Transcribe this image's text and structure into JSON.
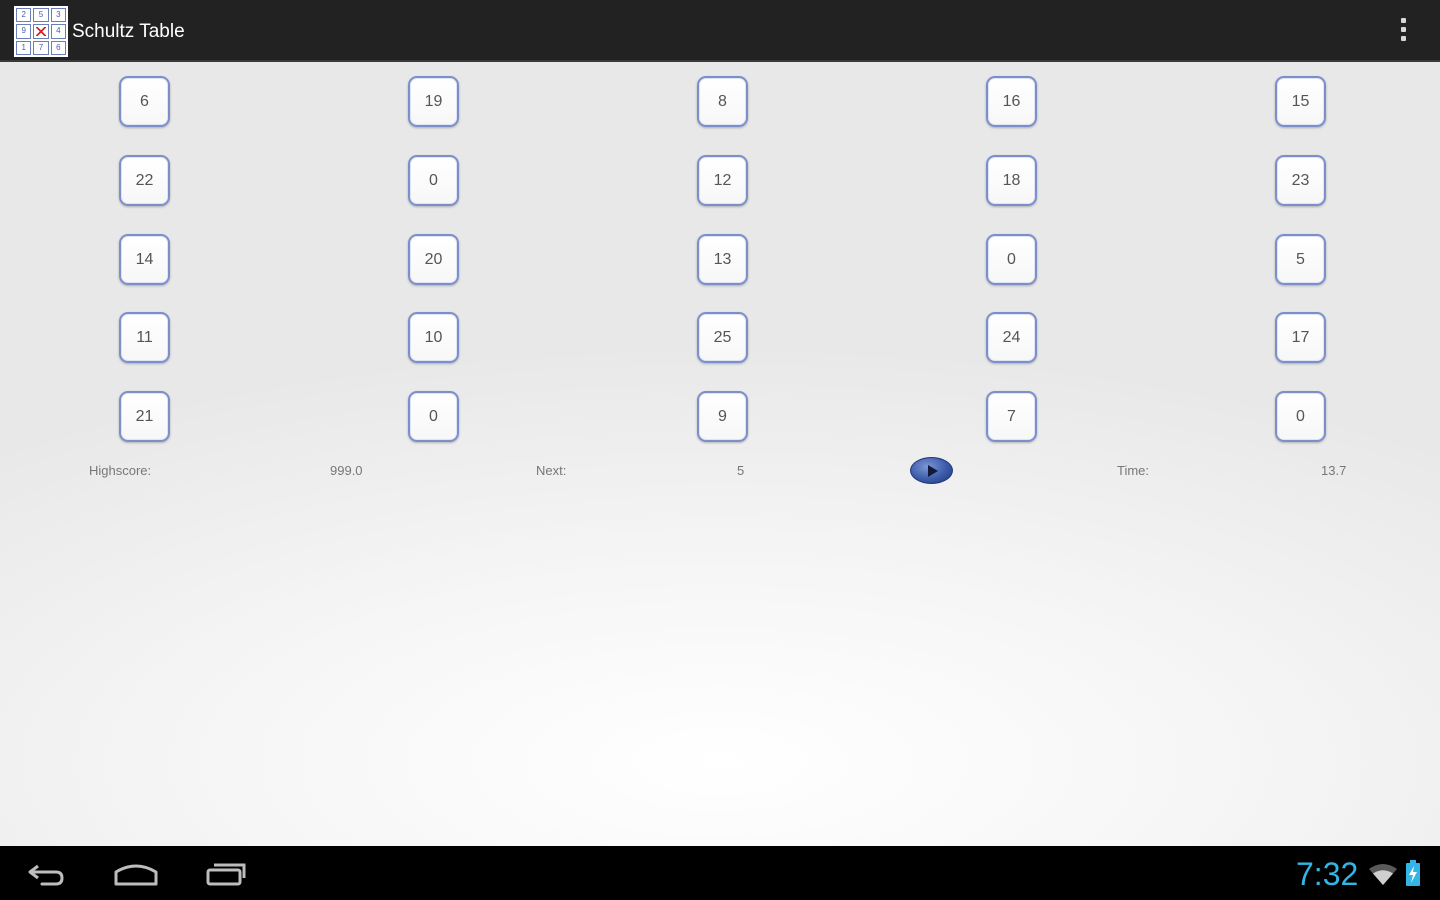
{
  "app": {
    "title": "Schultz Table",
    "icon": "schultz-table-app-icon",
    "icon_digits": [
      "2",
      "5",
      "3",
      "9",
      "",
      "4",
      "1",
      "7",
      "6"
    ]
  },
  "table": {
    "rows": [
      [
        "6",
        "19",
        "8",
        "16",
        "15"
      ],
      [
        "22",
        "0",
        "12",
        "18",
        "23"
      ],
      [
        "14",
        "20",
        "13",
        "0",
        "5"
      ],
      [
        "11",
        "10",
        "25",
        "24",
        "17"
      ],
      [
        "21",
        "0",
        "9",
        "7",
        "0"
      ]
    ]
  },
  "status": {
    "highscore_label": "Highscore:",
    "highscore_value": "999.0",
    "next_label": "Next:",
    "next_value": "5",
    "time_label": "Time:",
    "time_value": "13.7"
  },
  "system": {
    "clock": "7:32",
    "accent_color": "#33b5e5"
  }
}
